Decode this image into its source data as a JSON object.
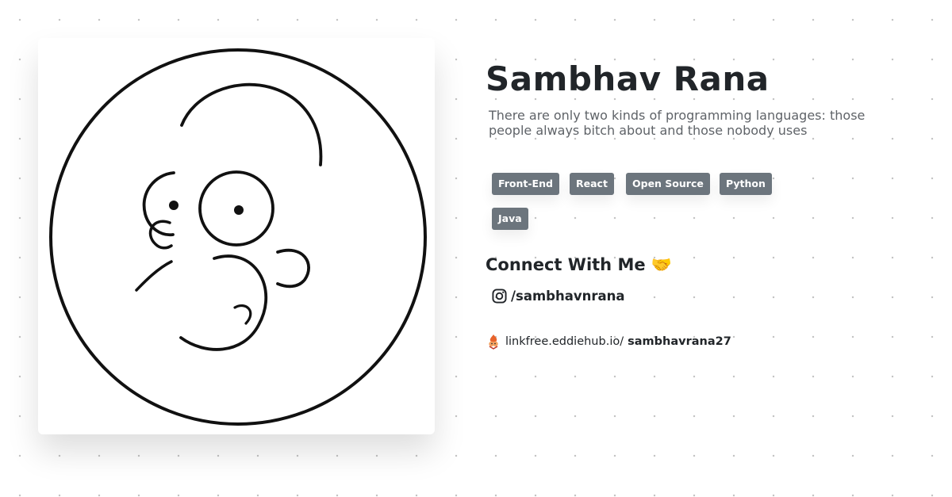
{
  "profile": {
    "name": "Sambhav Rana",
    "bio": "There are only two kinds of programming languages: those people always bitch about and those nobody uses",
    "avatar_icon": "homer-simpson-line-art"
  },
  "tags": [
    "Front-End",
    "React",
    "Open Source",
    "Python",
    "Java"
  ],
  "connect": {
    "title": "Connect With Me 🤝",
    "instagram_icon": "instagram-icon",
    "instagram_handle": "/sambhavnrana"
  },
  "linkfree": {
    "icon": "linkfree-logo-icon",
    "domain": "linkfree.eddiehub.io/",
    "username": "sambhavrana27"
  },
  "colors": {
    "tag_background": "#6c757d",
    "heading": "#212529",
    "bio_text": "#5f6368",
    "background_dots": "#c2c2c2"
  }
}
